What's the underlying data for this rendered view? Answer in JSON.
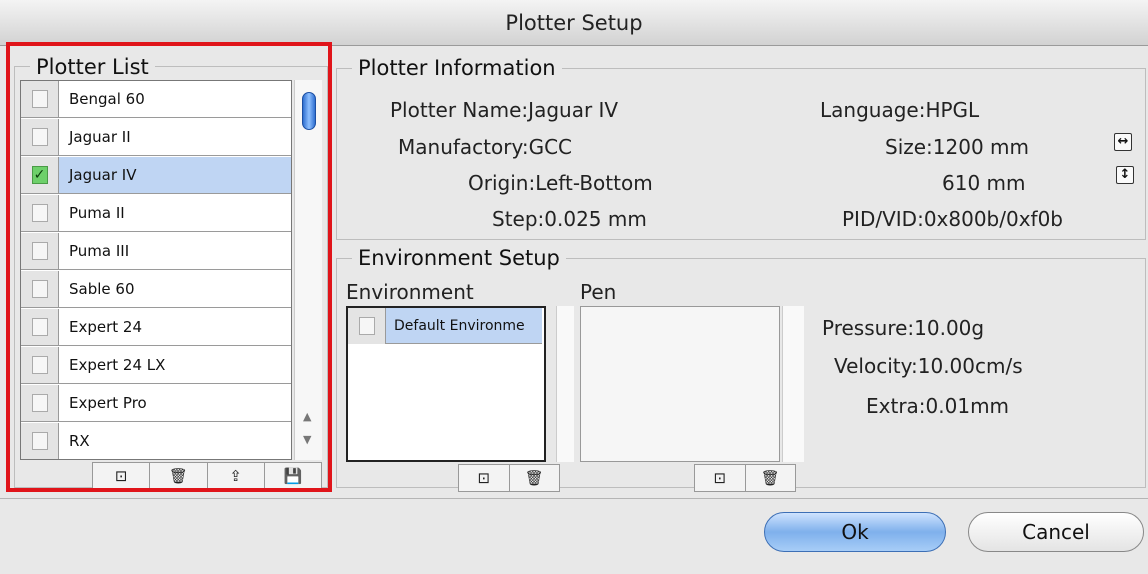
{
  "window": {
    "title": "Plotter Setup"
  },
  "plotter_list": {
    "title": "Plotter List",
    "items": [
      {
        "label": "Bengal 60",
        "checked": false,
        "selected": false
      },
      {
        "label": "Jaguar II",
        "checked": false,
        "selected": false
      },
      {
        "label": "Jaguar IV",
        "checked": true,
        "selected": true
      },
      {
        "label": "Puma II",
        "checked": false,
        "selected": false
      },
      {
        "label": "Puma III",
        "checked": false,
        "selected": false
      },
      {
        "label": "Sable 60",
        "checked": false,
        "selected": false
      },
      {
        "label": "Expert 24",
        "checked": false,
        "selected": false
      },
      {
        "label": "Expert 24 LX",
        "checked": false,
        "selected": false
      },
      {
        "label": "Expert Pro",
        "checked": false,
        "selected": false
      },
      {
        "label": "RX",
        "checked": false,
        "selected": false
      }
    ],
    "toolbar_icons": [
      "new-icon",
      "delete-icon",
      "export-icon",
      "save-icon"
    ]
  },
  "plotter_info": {
    "title": "Plotter Information",
    "plotter_name": "Plotter Name:Jaguar IV",
    "manufactory": "Manufactory:GCC",
    "origin": "Origin:Left-Bottom",
    "step": "Step:0.025 mm",
    "language": "Language:HPGL",
    "size_width": "Size:1200 mm",
    "size_height": "610 mm",
    "pid_vid": "PID/VID:0x800b/0xf0b"
  },
  "environment_setup": {
    "title": "Environment Setup",
    "environment_label": "Environment",
    "pen_label": "Pen",
    "environments": [
      {
        "label": "Default Environme",
        "checked": false
      }
    ],
    "pressure": "Pressure:10.00g",
    "velocity": "Velocity:10.00cm/s",
    "extra": "Extra:0.01mm"
  },
  "buttons": {
    "ok": "Ok",
    "cancel": "Cancel"
  },
  "colors": {
    "highlight": "#e0141a",
    "selection": "#bfd5f3",
    "ok_button": "#7fb0ec",
    "check_on": "#6ed06a"
  }
}
